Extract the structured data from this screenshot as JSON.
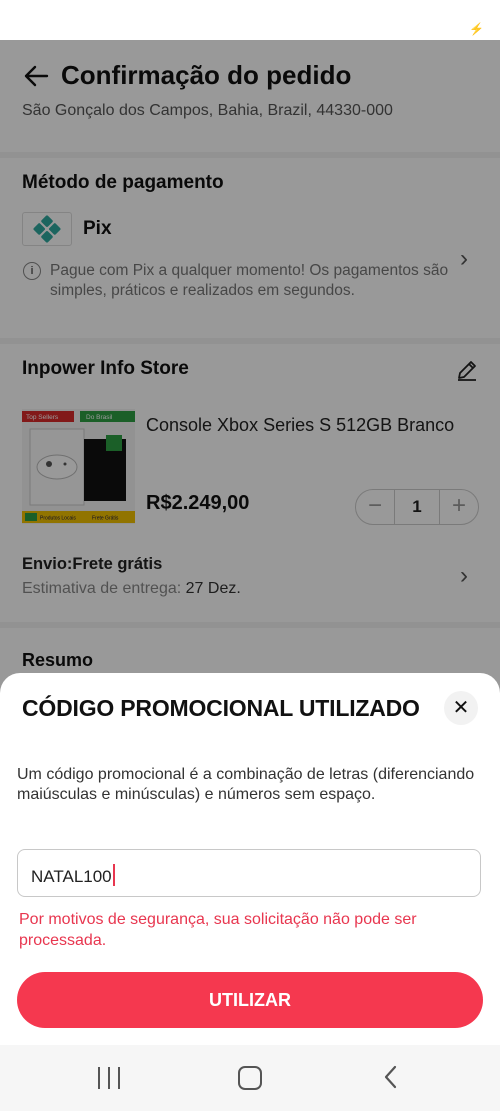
{
  "header": {
    "title": "Confirmação do pedido",
    "address": "São Gonçalo dos Campos, Bahia, Brazil, 44330-000"
  },
  "payment": {
    "section_title": "Método de pagamento",
    "method": "Pix",
    "description": "Pague com Pix a qualquer momento! Os pagamentos são simples, práticos e realizados em segundos."
  },
  "store": {
    "name": "Inpower Info Store",
    "product": {
      "name": "Console Xbox Series S 512GB  Branco",
      "price": "R$2.249,00",
      "quantity": "1",
      "image_tags": [
        "Top Sellers",
        "Do Brasil",
        "Produtos Locais",
        "Frete Grátis"
      ]
    },
    "shipping_title": "Envio:Frete grátis",
    "delivery_label": "Estimativa de entrega:",
    "delivery_date": "27 Dez."
  },
  "summary": {
    "title": "Resumo"
  },
  "promo_sheet": {
    "title": "CÓDIGO PROMOCIONAL UTILIZADO",
    "description": "Um código promocional é a combinação de letras (diferenciando maiúsculas e minúsculas) e números sem espaço.",
    "input_value": "NATAL100",
    "error": "Por motivos de segurança, sua solicitação não pode ser processada.",
    "button_label": "UTILIZAR",
    "error_color": "#e8364f",
    "accent_color": "#f5384f"
  },
  "icons": {
    "back": "arrow-left-icon",
    "edit": "pencil-icon",
    "info": "info-icon",
    "close": "close-icon",
    "chevron": "chevron-right-icon"
  }
}
